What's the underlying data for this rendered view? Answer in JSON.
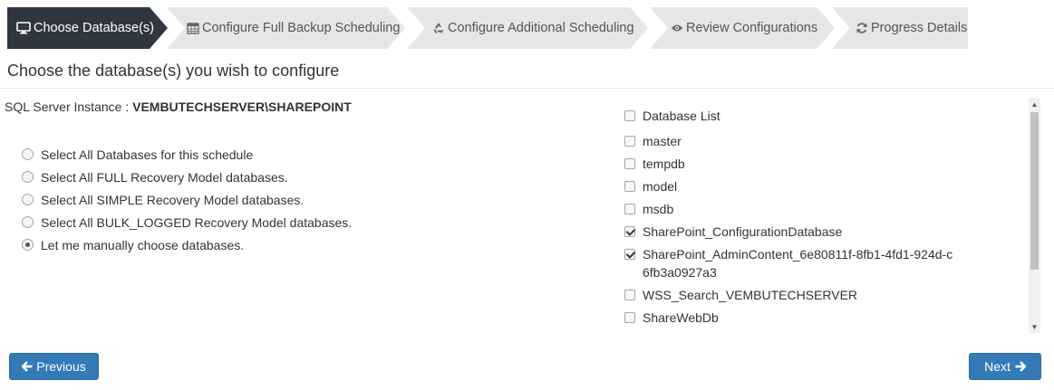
{
  "wizard": {
    "steps": [
      {
        "label": "Choose Database(s)",
        "icon": "monitor-icon",
        "active": true
      },
      {
        "label": "Configure Full Backup Scheduling",
        "icon": "calendar-icon",
        "active": false
      },
      {
        "label": "Configure Additional Scheduling",
        "icon": "recycle-icon",
        "active": false
      },
      {
        "label": "Review Configurations",
        "icon": "eye-icon",
        "active": false
      },
      {
        "label": "Progress Details",
        "icon": "refresh-icon",
        "active": false
      }
    ]
  },
  "page": {
    "title": "Choose the database(s) you wish to configure"
  },
  "instance": {
    "label": "SQL Server Instance : ",
    "value": "VEMBUTECHSERVER\\SHAREPOINT"
  },
  "selection_options": [
    {
      "label": "Select All Databases for this schedule",
      "selected": false
    },
    {
      "label": "Select All FULL Recovery Model databases.",
      "selected": false
    },
    {
      "label": "Select All SIMPLE Recovery Model databases.",
      "selected": false
    },
    {
      "label": "Select All BULK_LOGGED Recovery Model databases.",
      "selected": false
    },
    {
      "label": "Let me manually choose databases.",
      "selected": true
    }
  ],
  "database_list": {
    "header": "Database List",
    "header_checked": false,
    "items": [
      {
        "name": "master",
        "checked": false
      },
      {
        "name": "tempdb",
        "checked": false
      },
      {
        "name": "model",
        "checked": false
      },
      {
        "name": "msdb",
        "checked": false
      },
      {
        "name": "SharePoint_ConfigurationDatabase",
        "checked": true
      },
      {
        "name": "SharePoint_AdminContent_6e80811f-8fb1-4fd1-924d-c6fb3a0927a3",
        "checked": true
      },
      {
        "name": "WSS_Search_VEMBUTECHSERVER",
        "checked": false
      },
      {
        "name": "ShareWebDb",
        "checked": false
      }
    ]
  },
  "buttons": {
    "previous": "Previous",
    "next": "Next"
  },
  "colors": {
    "active_step": "#2f3640",
    "inactive_step": "#e6e6e6",
    "primary": "#337ab7"
  }
}
